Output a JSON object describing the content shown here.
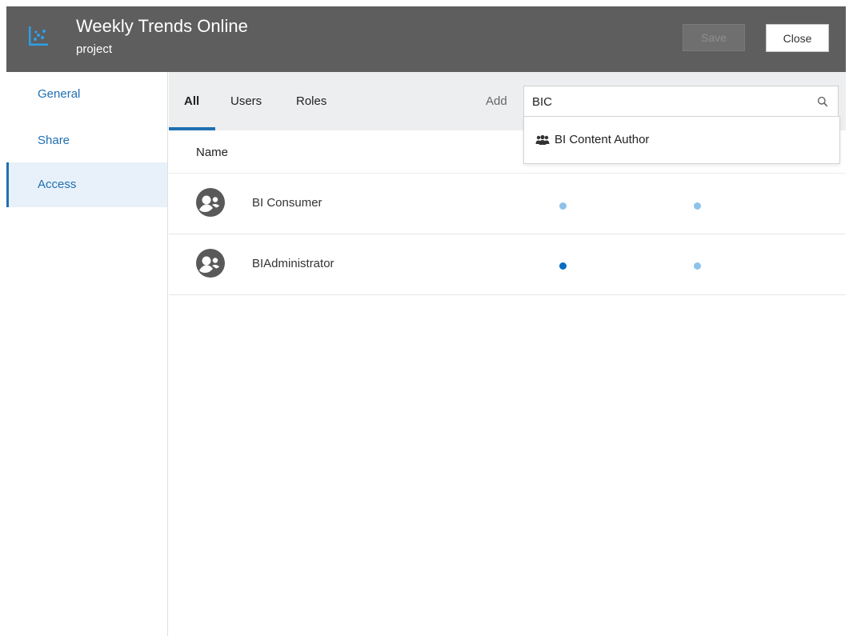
{
  "header": {
    "title": "Weekly Trends Online",
    "subtitle": "project",
    "save_label": "Save",
    "close_label": "Close",
    "icon": "chart-icon"
  },
  "sidebar": {
    "items": [
      {
        "label": "General",
        "active": false
      },
      {
        "label": "Share",
        "active": false
      },
      {
        "label": "Access",
        "active": true
      }
    ]
  },
  "tabs": [
    {
      "label": "All",
      "active": true
    },
    {
      "label": "Users",
      "active": false
    },
    {
      "label": "Roles",
      "active": false
    }
  ],
  "search": {
    "add_label": "Add",
    "value": "BIC",
    "icon": "search-icon"
  },
  "dropdown": {
    "options": [
      {
        "label": "BI Content Author",
        "icon": "group-icon"
      }
    ]
  },
  "table": {
    "column_name": "Name",
    "rows": [
      {
        "name": "BI Consumer",
        "dot1": "light",
        "dot2": "light"
      },
      {
        "name": "BIAdministrator",
        "dot1": "dark",
        "dot2": "light"
      }
    ]
  },
  "colors": {
    "header_bg": "#5e5e5e",
    "accent": "#1f6fb2",
    "dot_light": "#8ec2ea",
    "dot_dark": "#0a6cc4",
    "tabbar_bg": "#edeef0",
    "active_side_bg": "#e8f1fa"
  }
}
